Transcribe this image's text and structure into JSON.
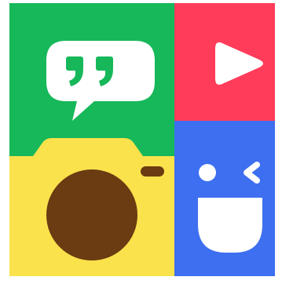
{
  "app_icon": {
    "tiles": {
      "chat": {
        "color": "#16b85a",
        "icon": "quote-bubble-icon"
      },
      "video": {
        "color": "#ff3c5a",
        "icon": "play-icon"
      },
      "camera": {
        "color": "#fae24c",
        "icon": "camera-icon"
      },
      "face": {
        "color": "#3d6ff0",
        "icon": "wink-face-icon"
      }
    },
    "accents": {
      "bubble": "#ffffff",
      "quote_marks": "#16b85a",
      "camera_lens": "#6b3b12",
      "camera_viewfinder": "#6b3b12",
      "face_features": "#ffffff"
    }
  }
}
